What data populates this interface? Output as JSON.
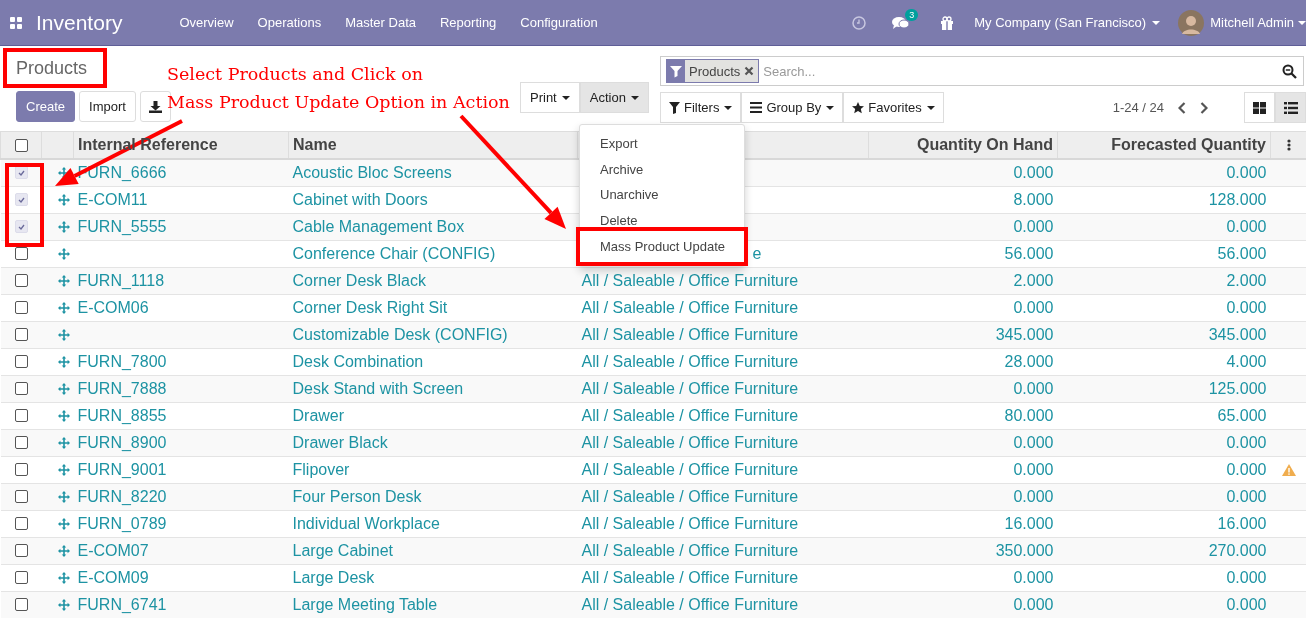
{
  "navbar": {
    "app_title": "Inventory",
    "menu": [
      "Overview",
      "Operations",
      "Master Data",
      "Reporting",
      "Configuration"
    ],
    "messages_badge": "3",
    "company": "My Company (San Francisco)",
    "user": "Mitchell Admin"
  },
  "control_panel": {
    "breadcrumb": "Products",
    "buttons": {
      "create": "Create",
      "import": "Import"
    },
    "print": "Print",
    "action": "Action",
    "search": {
      "facet": "Products",
      "placeholder": "Search..."
    },
    "filters": "Filters",
    "group_by": "Group By",
    "favorites": "Favorites",
    "pager": "1-24 / 24",
    "views": [
      {
        "kind": "kanban",
        "selected": false
      },
      {
        "kind": "list",
        "selected": true
      }
    ]
  },
  "action_menu": {
    "items": [
      {
        "label": "Export",
        "highlighted": false
      },
      {
        "label": "Archive",
        "highlighted": false
      },
      {
        "label": "Unarchive",
        "highlighted": false
      },
      {
        "label": "Delete",
        "highlighted": false
      },
      {
        "label": "Mass Product Update",
        "highlighted": true
      }
    ]
  },
  "table": {
    "columns": [
      "Internal Reference",
      "Name",
      "Quantity On Hand",
      "Forecasted Quantity"
    ],
    "all_checked": false,
    "rows": [
      {
        "checked": true,
        "reference": "FURN_6666",
        "name": "Acoustic Bloc Screens",
        "on_hand": "0.000",
        "forecast": "0.000"
      },
      {
        "checked": true,
        "reference": "E-COM11",
        "name": "Cabinet with Doors",
        "on_hand": "8.000",
        "forecast": "128.000"
      },
      {
        "checked": true,
        "reference": "FURN_5555",
        "name": "Cable Management Box",
        "on_hand": "0.000",
        "forecast": "0.000"
      },
      {
        "checked": false,
        "name": "Conference Chair (CONFIG)",
        "category": "e",
        "category_covered": true,
        "on_hand": "56.000",
        "forecast": "56.000"
      },
      {
        "checked": false,
        "reference": "FURN_1118",
        "name": "Corner Desk Black",
        "category": "All / Saleable / Office Furniture",
        "on_hand": "2.000",
        "forecast": "2.000"
      },
      {
        "checked": false,
        "reference": "E-COM06",
        "name": "Corner Desk Right Sit",
        "category": "All / Saleable / Office Furniture",
        "on_hand": "0.000",
        "forecast": "0.000"
      },
      {
        "checked": false,
        "name": "Customizable Desk (CONFIG)",
        "category": "All / Saleable / Office Furniture",
        "on_hand": "345.000",
        "forecast": "345.000"
      },
      {
        "checked": false,
        "reference": "FURN_7800",
        "name": "Desk Combination",
        "category": "All / Saleable / Office Furniture",
        "on_hand": "28.000",
        "forecast": "4.000"
      },
      {
        "checked": false,
        "reference": "FURN_7888",
        "name": "Desk Stand with Screen",
        "category": "All / Saleable / Office Furniture",
        "on_hand": "0.000",
        "forecast": "125.000"
      },
      {
        "checked": false,
        "reference": "FURN_8855",
        "name": "Drawer",
        "category": "All / Saleable / Office Furniture",
        "on_hand": "80.000",
        "forecast": "65.000"
      },
      {
        "checked": false,
        "reference": "FURN_8900",
        "name": "Drawer Black",
        "category": "All / Saleable / Office Furniture",
        "on_hand": "0.000",
        "forecast": "0.000"
      },
      {
        "checked": false,
        "reference": "FURN_9001",
        "name": "Flipover",
        "category": "All / Saleable / Office Furniture",
        "on_hand": "0.000",
        "forecast": "0.000",
        "warning": true
      },
      {
        "checked": false,
        "reference": "FURN_8220",
        "name": "Four Person Desk",
        "category": "All / Saleable / Office Furniture",
        "on_hand": "0.000",
        "forecast": "0.000"
      },
      {
        "checked": false,
        "reference": "FURN_0789",
        "name": "Individual Workplace",
        "category": "All / Saleable / Office Furniture",
        "on_hand": "16.000",
        "forecast": "16.000"
      },
      {
        "checked": false,
        "reference": "E-COM07",
        "name": "Large Cabinet",
        "category": "All / Saleable / Office Furniture",
        "on_hand": "350.000",
        "forecast": "270.000"
      },
      {
        "checked": false,
        "reference": "E-COM09",
        "name": "Large Desk",
        "category": "All / Saleable / Office Furniture",
        "on_hand": "0.000",
        "forecast": "0.000"
      },
      {
        "checked": false,
        "reference": "FURN_6741",
        "name": "Large Meeting Table",
        "category": "All / Saleable / Office Furniture",
        "on_hand": "0.000",
        "forecast": "0.000"
      }
    ]
  },
  "annotation": {
    "lines": [
      "Select Products and Click on",
      "Mass Product Update Option in Action"
    ]
  }
}
